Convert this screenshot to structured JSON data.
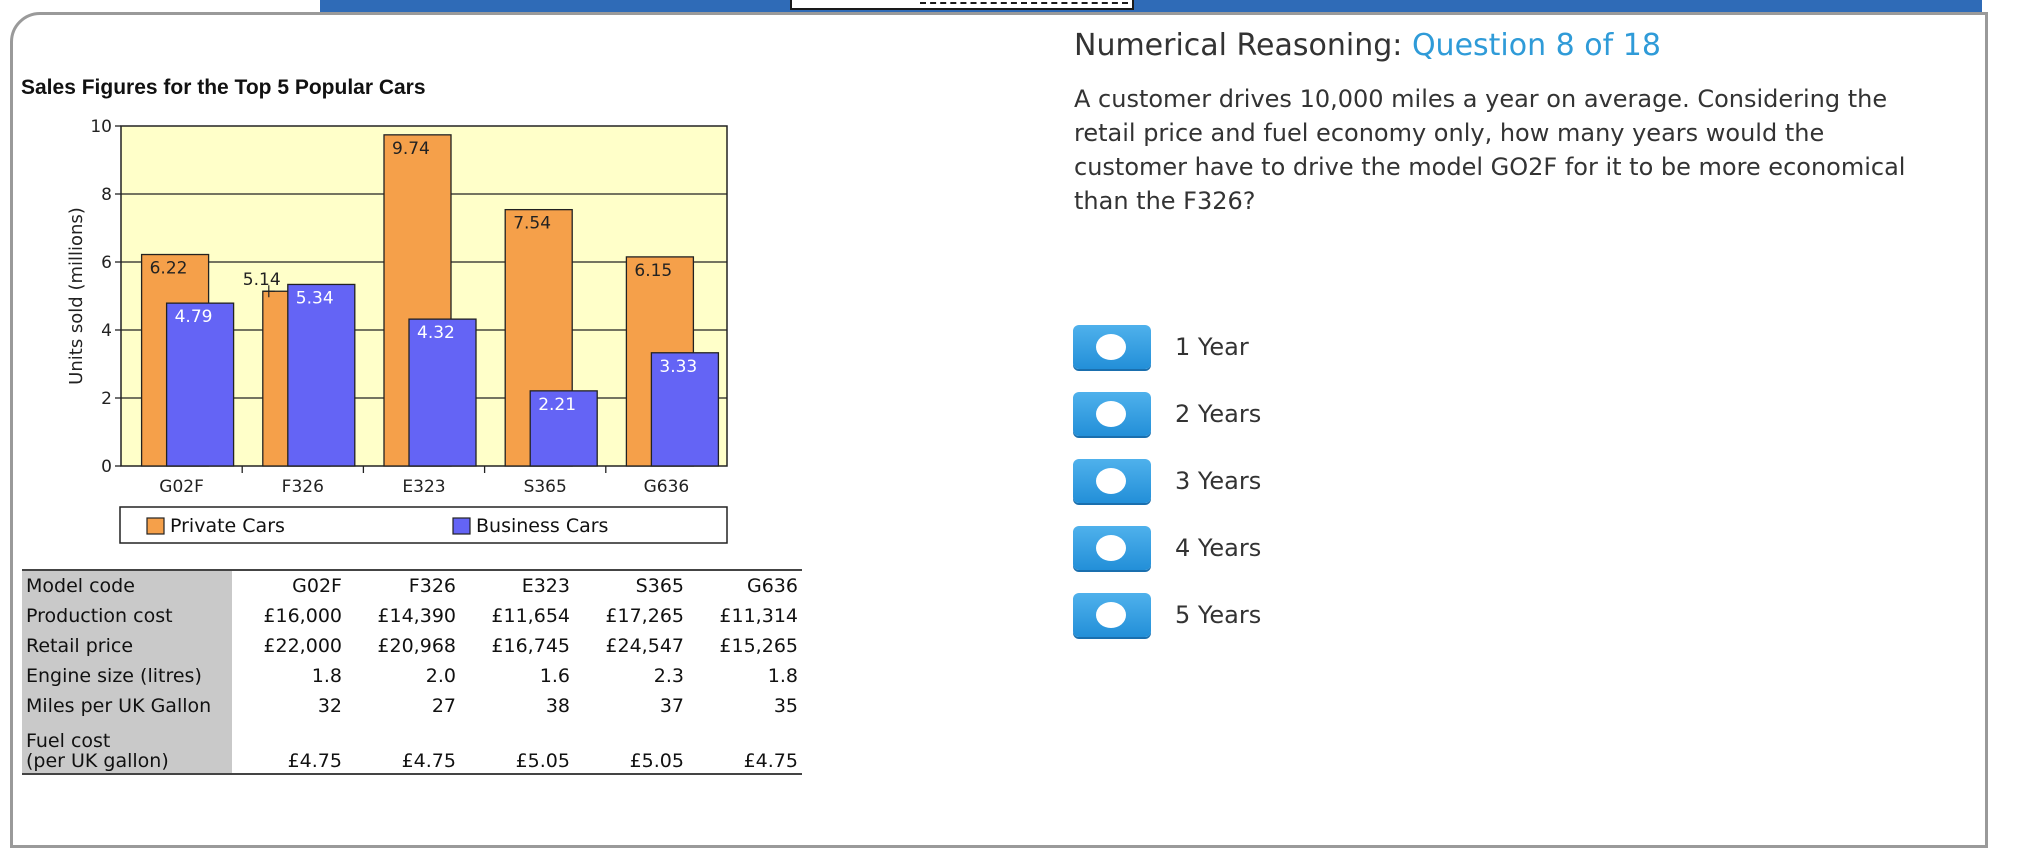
{
  "question": {
    "title_prefix": "Numerical Reasoning:",
    "question_counter": "Question 8 of 18",
    "text": "A customer drives 10,000 miles a year on average. Considering the retail price and fuel economy only, how many years would the customer have to drive the model GO2F for it to be more economical than the F326?",
    "options": [
      "1 Year",
      "2 Years",
      "3 Years",
      "4 Years",
      "5 Years"
    ]
  },
  "chart_data": {
    "type": "bar",
    "title": "Sales Figures for the Top 5 Popular Cars",
    "ylabel": "Units sold (millions)",
    "xlabel": "",
    "ylim": [
      0,
      10
    ],
    "yticks": [
      "0",
      "2",
      "4",
      "6",
      "8",
      "10"
    ],
    "categories": [
      "G02F",
      "F326",
      "E323",
      "S365",
      "G636"
    ],
    "series": [
      {
        "name": "Private Cars",
        "values": [
          6.22,
          5.14,
          9.74,
          7.54,
          6.15
        ],
        "labels": [
          "6.22",
          "5.14",
          "9.74",
          "7.54",
          "6.15"
        ],
        "color": "#f5a04a"
      },
      {
        "name": "Business Cars",
        "values": [
          4.79,
          5.34,
          4.32,
          2.21,
          3.33
        ],
        "labels": [
          "4.79",
          "5.34",
          "4.32",
          "2.21",
          "3.33"
        ],
        "color": "#6464f5"
      }
    ],
    "plot_background": "#ffffc9",
    "grid": true,
    "legend": "bottom"
  },
  "table": {
    "headers": [
      "Model code",
      "G02F",
      "F326",
      "E323",
      "S365",
      "G636"
    ],
    "rows": [
      {
        "label": "Production cost",
        "values": [
          "£16,000",
          "£14,390",
          "£11,654",
          "£17,265",
          "£11,314"
        ]
      },
      {
        "label": "Retail price",
        "values": [
          "£22,000",
          "£20,968",
          "£16,745",
          "£24,547",
          "£15,265"
        ]
      },
      {
        "label": "Engine size (litres)",
        "values": [
          "1.8",
          "2.0",
          "1.6",
          "2.3",
          "1.8"
        ]
      },
      {
        "label": "Miles per UK Gallon",
        "values": [
          "32",
          "27",
          "38",
          "37",
          "35"
        ]
      }
    ],
    "fuel_row": {
      "label_line1": "Fuel cost",
      "label_line2": "(per UK gallon)",
      "values": [
        "£4.75",
        "£4.75",
        "£5.05",
        "£5.05",
        "£4.75"
      ]
    }
  },
  "colors": {
    "accent": "#2f9bd8",
    "topbar": "#2f6bb7",
    "radio": "#2e9ee6"
  }
}
